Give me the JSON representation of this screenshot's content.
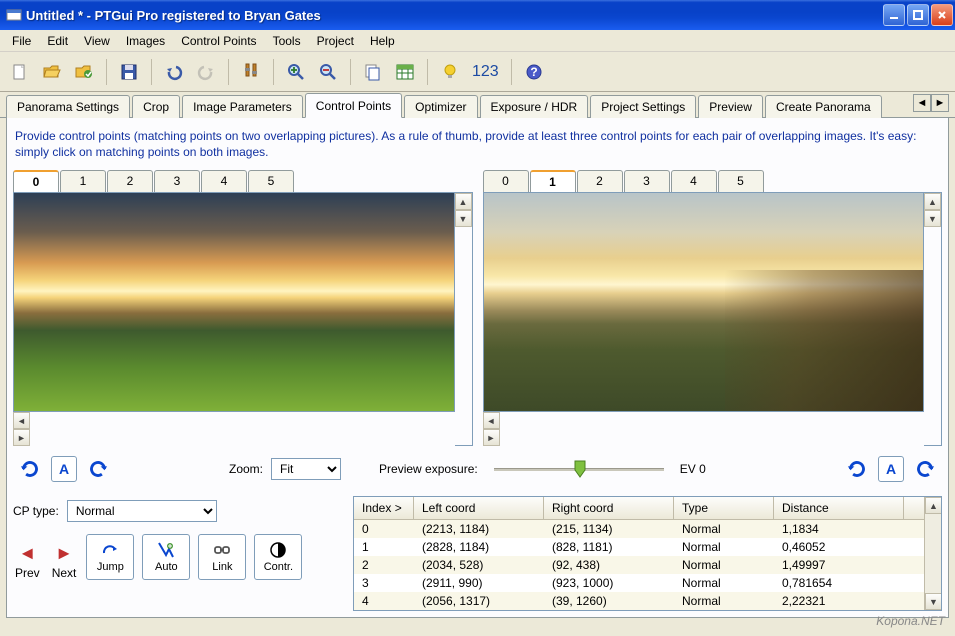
{
  "window_title": "Untitled * - PTGui Pro registered to Bryan Gates",
  "menu": [
    "File",
    "Edit",
    "View",
    "Images",
    "Control Points",
    "Tools",
    "Project",
    "Help"
  ],
  "toolbar_counter": "123",
  "tabs": [
    "Panorama Settings",
    "Crop",
    "Image Parameters",
    "Control Points",
    "Optimizer",
    "Exposure / HDR",
    "Project Settings",
    "Preview",
    "Create Panorama"
  ],
  "active_tab": 3,
  "hint": "Provide control points (matching points on two overlapping pictures). As a rule of thumb, provide at least three control points for each pair of overlapping images. It's easy: simply click on matching points on both images.",
  "image_tabs": [
    "0",
    "1",
    "2",
    "3",
    "4",
    "5"
  ],
  "left_active": 0,
  "right_active": 1,
  "zoom_label": "Zoom:",
  "zoom_value": "Fit",
  "preview_exposure_label": "Preview exposure:",
  "ev_label": "EV 0",
  "cp_type_label": "CP type:",
  "cp_type_value": "Normal",
  "nav": {
    "prev": "Prev",
    "next": "Next",
    "jump": "Jump",
    "auto": "Auto",
    "link": "Link",
    "contr": "Contr."
  },
  "table_headers": [
    "Index >",
    "Left coord",
    "Right coord",
    "Type",
    "Distance"
  ],
  "rows": [
    {
      "i": "0",
      "l": "(2213, 1184)",
      "r": "(215, 1134)",
      "t": "Normal",
      "d": "1,1834"
    },
    {
      "i": "1",
      "l": "(2828, 1184)",
      "r": "(828, 1181)",
      "t": "Normal",
      "d": "0,46052"
    },
    {
      "i": "2",
      "l": "(2034, 528)",
      "r": "(92, 438)",
      "t": "Normal",
      "d": "1,49997"
    },
    {
      "i": "3",
      "l": "(2911, 990)",
      "r": "(923, 1000)",
      "t": "Normal",
      "d": "0,781654"
    },
    {
      "i": "4",
      "l": "(2056, 1317)",
      "r": "(39, 1260)",
      "t": "Normal",
      "d": "2,22321"
    }
  ],
  "watermark": "Kopona.NET"
}
